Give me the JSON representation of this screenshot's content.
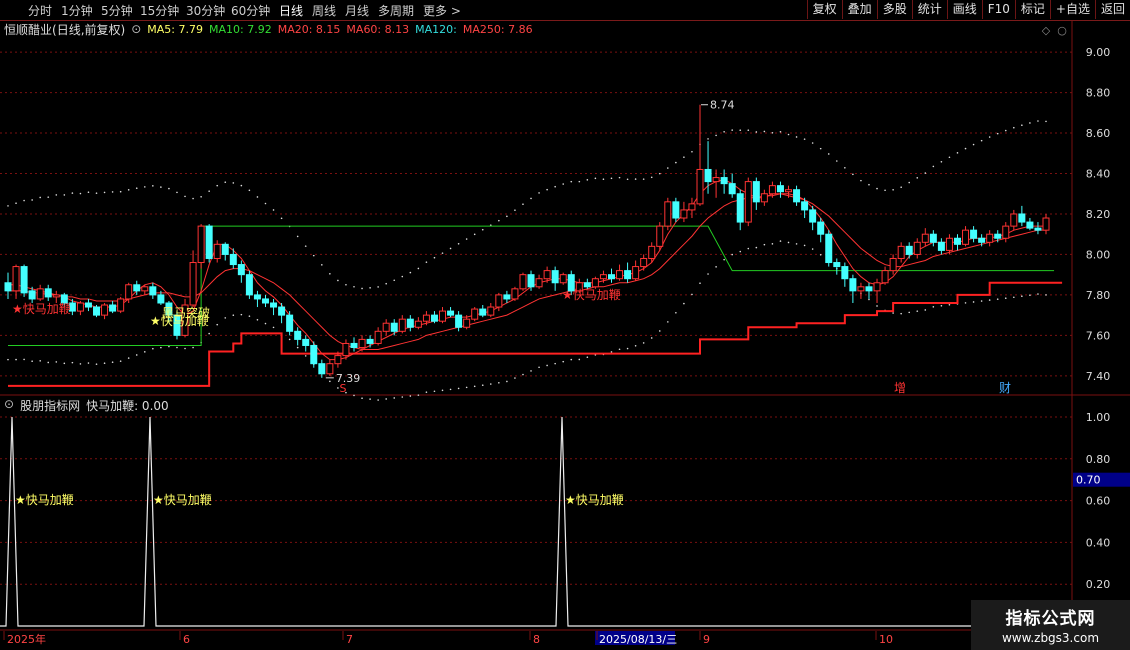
{
  "toolbar": {
    "periods": [
      "分时",
      "1分钟",
      "5分钟",
      "15分钟",
      "30分钟",
      "60分钟",
      "日线",
      "周线",
      "月线",
      "多周期",
      "更多 >"
    ],
    "active_period": "日线",
    "buttons": [
      "复权",
      "叠加",
      "多股",
      "统计",
      "画线",
      "F10",
      "标记",
      "+自选",
      "返回"
    ]
  },
  "stock": {
    "name": "恒顺醋业",
    "mode": "(日线,前复权)"
  },
  "ma_legend": [
    {
      "label": "MA5: 7.79",
      "color": "#ffff66"
    },
    {
      "label": "MA10: 7.92",
      "color": "#33dd33"
    },
    {
      "label": "MA20: 8.15",
      "color": "#ff4444"
    },
    {
      "label": "MA60: 8.13",
      "color": "#ff4444"
    },
    {
      "label": "MA120:",
      "color": "#33dddd"
    },
    {
      "label": "MA250: 7.86",
      "color": "#ff4444"
    }
  ],
  "price_axis": [
    "9.00",
    "8.80",
    "8.60",
    "8.40",
    "8.20",
    "8.00",
    "7.80",
    "7.60",
    "7.40"
  ],
  "annotations": {
    "high": "8.74",
    "low": "7.39",
    "signal_a": "★快马加鞭",
    "signal_b": "★快马加鞭",
    "signal_c": "★快马加鞭",
    "breakout": "黑马突破",
    "event_s": "S",
    "event_zeng": "增",
    "event_cai": "财"
  },
  "sub": {
    "name": "股朋指标网",
    "value_label": "快马加鞭: 0.00",
    "axis": [
      "1.00",
      "0.80",
      "0.60",
      "0.40",
      "0.20"
    ],
    "cursor_value": "0.70",
    "signal_label": "★快马加鞭"
  },
  "date_axis": [
    "2025年",
    "6",
    "7",
    "8",
    "2025/08/13/三",
    "9",
    "10"
  ],
  "watermark": {
    "line1": "指标公式网",
    "line2": "www.zbgs3.com"
  },
  "colors": {
    "up": "#ff3333",
    "down": "#44ffff",
    "grid": "#7a1010",
    "support": "#ff2222",
    "green": "#22cc22",
    "dots": "#dddddd"
  },
  "chart_data": {
    "type": "candlestick",
    "ylim": [
      7.32,
      9.06
    ],
    "candles": [
      [
        7.86,
        7.82,
        7.91,
        7.78
      ],
      [
        7.82,
        7.94,
        7.95,
        7.78
      ],
      [
        7.94,
        7.81,
        7.95,
        7.79
      ],
      [
        7.82,
        7.78,
        7.84,
        7.76
      ],
      [
        7.78,
        7.83,
        7.85,
        7.77
      ],
      [
        7.83,
        7.79,
        7.85,
        7.77
      ],
      [
        7.79,
        7.8,
        7.82,
        7.76
      ],
      [
        7.8,
        7.76,
        7.81,
        7.74
      ],
      [
        7.76,
        7.72,
        7.78,
        7.7
      ],
      [
        7.72,
        7.76,
        7.77,
        7.7
      ],
      [
        7.76,
        7.74,
        7.78,
        7.72
      ],
      [
        7.74,
        7.7,
        7.75,
        7.69
      ],
      [
        7.7,
        7.75,
        7.76,
        7.68
      ],
      [
        7.75,
        7.72,
        7.77,
        7.71
      ],
      [
        7.72,
        7.78,
        7.79,
        7.71
      ],
      [
        7.78,
        7.85,
        7.86,
        7.76
      ],
      [
        7.85,
        7.82,
        7.87,
        7.8
      ],
      [
        7.82,
        7.84,
        7.85,
        7.8
      ],
      [
        7.84,
        7.8,
        7.86,
        7.78
      ],
      [
        7.8,
        7.76,
        7.82,
        7.75
      ],
      [
        7.76,
        7.7,
        7.77,
        7.66
      ],
      [
        7.7,
        7.6,
        7.72,
        7.58
      ],
      [
        7.6,
        7.75,
        7.78,
        7.59
      ],
      [
        7.75,
        7.96,
        8.02,
        7.74
      ],
      [
        7.96,
        8.14,
        8.15,
        7.93
      ],
      [
        8.14,
        7.98,
        8.15,
        7.96
      ],
      [
        7.98,
        8.05,
        8.07,
        7.96
      ],
      [
        8.05,
        8.0,
        8.06,
        7.97
      ],
      [
        8.0,
        7.95,
        8.03,
        7.93
      ],
      [
        7.95,
        7.9,
        7.97,
        7.86
      ],
      [
        7.9,
        7.8,
        7.92,
        7.78
      ],
      [
        7.8,
        7.78,
        7.82,
        7.74
      ],
      [
        7.78,
        7.76,
        7.8,
        7.74
      ],
      [
        7.76,
        7.74,
        7.78,
        7.7
      ],
      [
        7.74,
        7.7,
        7.76,
        7.66
      ],
      [
        7.7,
        7.62,
        7.72,
        7.6
      ],
      [
        7.62,
        7.58,
        7.64,
        7.55
      ],
      [
        7.58,
        7.55,
        7.6,
        7.52
      ],
      [
        7.55,
        7.46,
        7.57,
        7.44
      ],
      [
        7.46,
        7.41,
        7.48,
        7.39
      ],
      [
        7.41,
        7.46,
        7.48,
        7.4
      ],
      [
        7.46,
        7.5,
        7.52,
        7.44
      ],
      [
        7.5,
        7.56,
        7.58,
        7.48
      ],
      [
        7.56,
        7.54,
        7.59,
        7.52
      ],
      [
        7.54,
        7.58,
        7.6,
        7.52
      ],
      [
        7.58,
        7.56,
        7.6,
        7.54
      ],
      [
        7.56,
        7.62,
        7.64,
        7.55
      ],
      [
        7.62,
        7.66,
        7.68,
        7.6
      ],
      [
        7.66,
        7.62,
        7.68,
        7.6
      ],
      [
        7.62,
        7.68,
        7.7,
        7.61
      ],
      [
        7.68,
        7.64,
        7.7,
        7.62
      ],
      [
        7.64,
        7.67,
        7.69,
        7.63
      ],
      [
        7.67,
        7.7,
        7.72,
        7.65
      ],
      [
        7.7,
        7.67,
        7.72,
        7.66
      ],
      [
        7.67,
        7.72,
        7.74,
        7.66
      ],
      [
        7.72,
        7.7,
        7.74,
        7.69
      ],
      [
        7.7,
        7.64,
        7.72,
        7.62
      ],
      [
        7.64,
        7.68,
        7.7,
        7.63
      ],
      [
        7.68,
        7.73,
        7.74,
        7.67
      ],
      [
        7.73,
        7.7,
        7.75,
        7.69
      ],
      [
        7.7,
        7.74,
        7.76,
        7.69
      ],
      [
        7.74,
        7.8,
        7.81,
        7.72
      ],
      [
        7.8,
        7.78,
        7.82,
        7.76
      ],
      [
        7.78,
        7.83,
        7.84,
        7.77
      ],
      [
        7.83,
        7.9,
        7.91,
        7.82
      ],
      [
        7.9,
        7.84,
        7.92,
        7.82
      ],
      [
        7.84,
        7.88,
        7.9,
        7.83
      ],
      [
        7.88,
        7.92,
        7.94,
        7.86
      ],
      [
        7.92,
        7.86,
        7.94,
        7.82
      ],
      [
        7.86,
        7.9,
        7.91,
        7.85
      ],
      [
        7.9,
        7.82,
        7.92,
        7.8
      ],
      [
        7.82,
        7.86,
        7.88,
        7.81
      ],
      [
        7.86,
        7.84,
        7.88,
        7.83
      ],
      [
        7.84,
        7.88,
        7.89,
        7.83
      ],
      [
        7.88,
        7.9,
        7.92,
        7.86
      ],
      [
        7.9,
        7.88,
        7.93,
        7.86
      ],
      [
        7.88,
        7.92,
        7.95,
        7.87
      ],
      [
        7.92,
        7.88,
        7.96,
        7.86
      ],
      [
        7.88,
        7.94,
        7.97,
        7.87
      ],
      [
        7.94,
        7.98,
        8.0,
        7.92
      ],
      [
        7.98,
        8.04,
        8.06,
        7.96
      ],
      [
        8.04,
        8.14,
        8.16,
        8.02
      ],
      [
        8.14,
        8.26,
        8.28,
        8.12
      ],
      [
        8.26,
        8.18,
        8.28,
        8.16
      ],
      [
        8.18,
        8.22,
        8.26,
        8.16
      ],
      [
        8.22,
        8.25,
        8.28,
        8.18
      ],
      [
        8.25,
        8.42,
        8.74,
        8.24
      ],
      [
        8.42,
        8.36,
        8.56,
        8.3
      ],
      [
        8.36,
        8.38,
        8.42,
        8.28
      ],
      [
        8.38,
        8.35,
        8.42,
        8.3
      ],
      [
        8.35,
        8.3,
        8.4,
        8.28
      ],
      [
        8.3,
        8.16,
        8.32,
        8.12
      ],
      [
        8.16,
        8.36,
        8.38,
        8.14
      ],
      [
        8.36,
        8.26,
        8.38,
        8.22
      ],
      [
        8.26,
        8.3,
        8.32,
        8.24
      ],
      [
        8.3,
        8.34,
        8.36,
        8.28
      ],
      [
        8.34,
        8.31,
        8.36,
        8.28
      ],
      [
        8.31,
        8.32,
        8.34,
        8.28
      ],
      [
        8.32,
        8.26,
        8.34,
        8.24
      ],
      [
        8.26,
        8.22,
        8.28,
        8.18
      ],
      [
        8.22,
        8.16,
        8.24,
        8.12
      ],
      [
        8.16,
        8.1,
        8.18,
        8.06
      ],
      [
        8.1,
        7.96,
        8.12,
        7.94
      ],
      [
        7.96,
        7.94,
        7.98,
        7.9
      ],
      [
        7.94,
        7.88,
        7.96,
        7.84
      ],
      [
        7.88,
        7.82,
        7.9,
        7.76
      ],
      [
        7.82,
        7.84,
        7.86,
        7.78
      ],
      [
        7.84,
        7.82,
        7.86,
        7.78
      ],
      [
        7.82,
        7.86,
        7.88,
        7.76
      ],
      [
        7.86,
        7.92,
        7.94,
        7.85
      ],
      [
        7.92,
        7.98,
        8.0,
        7.9
      ],
      [
        7.98,
        8.04,
        8.06,
        7.96
      ],
      [
        8.04,
        8.0,
        8.06,
        7.98
      ],
      [
        8.0,
        8.06,
        8.08,
        7.98
      ],
      [
        8.06,
        8.1,
        8.13,
        8.04
      ],
      [
        8.1,
        8.06,
        8.12,
        8.04
      ],
      [
        8.06,
        8.02,
        8.08,
        8.0
      ],
      [
        8.02,
        8.08,
        8.1,
        8.0
      ],
      [
        8.08,
        8.05,
        8.1,
        8.02
      ],
      [
        8.05,
        8.12,
        8.14,
        8.04
      ],
      [
        8.12,
        8.08,
        8.14,
        8.06
      ],
      [
        8.08,
        8.06,
        8.1,
        8.04
      ],
      [
        8.06,
        8.1,
        8.12,
        8.04
      ],
      [
        8.1,
        8.08,
        8.12,
        8.06
      ],
      [
        8.08,
        8.14,
        8.16,
        8.06
      ],
      [
        8.14,
        8.2,
        8.22,
        8.12
      ],
      [
        8.2,
        8.16,
        8.24,
        8.14
      ],
      [
        8.16,
        8.13,
        8.18,
        8.12
      ],
      [
        8.13,
        8.12,
        8.16,
        8.1
      ],
      [
        8.12,
        8.18,
        8.2,
        8.1
      ]
    ],
    "ma_short": [
      7.85,
      7.85,
      7.84,
      7.83,
      7.82,
      7.81,
      7.8,
      7.79,
      7.77,
      7.76,
      7.75,
      7.74,
      7.74,
      7.74,
      7.75,
      7.78,
      7.82,
      7.85,
      7.86,
      7.84,
      7.8,
      7.74,
      7.7,
      7.72,
      7.82,
      7.95,
      8.05,
      8.05,
      8.02,
      7.98,
      7.92,
      7.86,
      7.82,
      7.79,
      7.75,
      7.7,
      7.65,
      7.61,
      7.56,
      7.51,
      7.48,
      7.48,
      7.49,
      7.51,
      7.53,
      7.55,
      7.57,
      7.59,
      7.61,
      7.63,
      7.64,
      7.65,
      7.66,
      7.67,
      7.68,
      7.69,
      7.69,
      7.69,
      7.7,
      7.71,
      7.72,
      7.74,
      7.76,
      7.78,
      7.81,
      7.84,
      7.86,
      7.87,
      7.88,
      7.88,
      7.87,
      7.86,
      7.86,
      7.86,
      7.87,
      7.88,
      7.89,
      7.9,
      7.91,
      7.93,
      7.96,
      8.02,
      8.1,
      8.16,
      8.2,
      8.24,
      8.3,
      8.34,
      8.36,
      8.37,
      8.35,
      8.32,
      8.3,
      8.28,
      8.28,
      8.3,
      8.3,
      8.3,
      8.29,
      8.27,
      8.23,
      8.18,
      8.12,
      8.05,
      7.99,
      7.93,
      7.89,
      7.86,
      7.85,
      7.86,
      7.89,
      7.94,
      7.99,
      8.02,
      8.04,
      8.06,
      8.06,
      8.06,
      8.06,
      8.07,
      8.08,
      8.08,
      8.08,
      8.09,
      8.1,
      8.12,
      8.13,
      8.14,
      8.14,
      8.14
    ],
    "ma_long": [
      7.82,
      7.82,
      7.82,
      7.81,
      7.81,
      7.8,
      7.8,
      7.79,
      7.79,
      7.78,
      7.78,
      7.77,
      7.77,
      7.77,
      7.77,
      7.78,
      7.79,
      7.8,
      7.81,
      7.81,
      7.81,
      7.8,
      7.79,
      7.79,
      7.81,
      7.85,
      7.89,
      7.92,
      7.93,
      7.93,
      7.92,
      7.9,
      7.88,
      7.86,
      7.83,
      7.8,
      7.76,
      7.72,
      7.68,
      7.64,
      7.6,
      7.57,
      7.55,
      7.54,
      7.53,
      7.53,
      7.53,
      7.54,
      7.55,
      7.56,
      7.57,
      7.58,
      7.6,
      7.61,
      7.62,
      7.63,
      7.64,
      7.65,
      7.66,
      7.67,
      7.68,
      7.69,
      7.7,
      7.72,
      7.74,
      7.76,
      7.78,
      7.79,
      7.8,
      7.81,
      7.82,
      7.82,
      7.83,
      7.84,
      7.84,
      7.85,
      7.86,
      7.86,
      7.87,
      7.88,
      7.9,
      7.93,
      7.97,
      8.01,
      8.05,
      8.09,
      8.14,
      8.18,
      8.21,
      8.24,
      8.26,
      8.27,
      8.28,
      8.28,
      8.29,
      8.29,
      8.3,
      8.29,
      8.28,
      8.27,
      8.25,
      8.22,
      8.19,
      8.15,
      8.11,
      8.07,
      8.03,
      8.0,
      7.97,
      7.95,
      7.94,
      7.94,
      7.95,
      7.96,
      7.97,
      7.99,
      8.0,
      8.01,
      8.02,
      8.03,
      8.04,
      8.05,
      8.06,
      8.07,
      8.08,
      8.09,
      8.1,
      8.11,
      8.12,
      8.12
    ],
    "support": [
      [
        0,
        7.35
      ],
      [
        24,
        7.35
      ],
      [
        25,
        7.52
      ],
      [
        28,
        7.56
      ],
      [
        29,
        7.61
      ],
      [
        33,
        7.61
      ],
      [
        34,
        7.51
      ],
      [
        85,
        7.51
      ],
      [
        86,
        7.58
      ],
      [
        92,
        7.64
      ],
      [
        98,
        7.66
      ],
      [
        104,
        7.7
      ],
      [
        108,
        7.72
      ],
      [
        110,
        7.76
      ],
      [
        118,
        7.8
      ],
      [
        122,
        7.86
      ],
      [
        131,
        7.86
      ]
    ],
    "green_box": {
      "from": 0,
      "to": 32,
      "base": 7.55,
      "top": 8.14
    },
    "green_box2": {
      "from": 32,
      "to": 130,
      "base": 7.92,
      "top": 8.14
    },
    "signal_peaks": [
      2,
      36,
      103
    ]
  }
}
